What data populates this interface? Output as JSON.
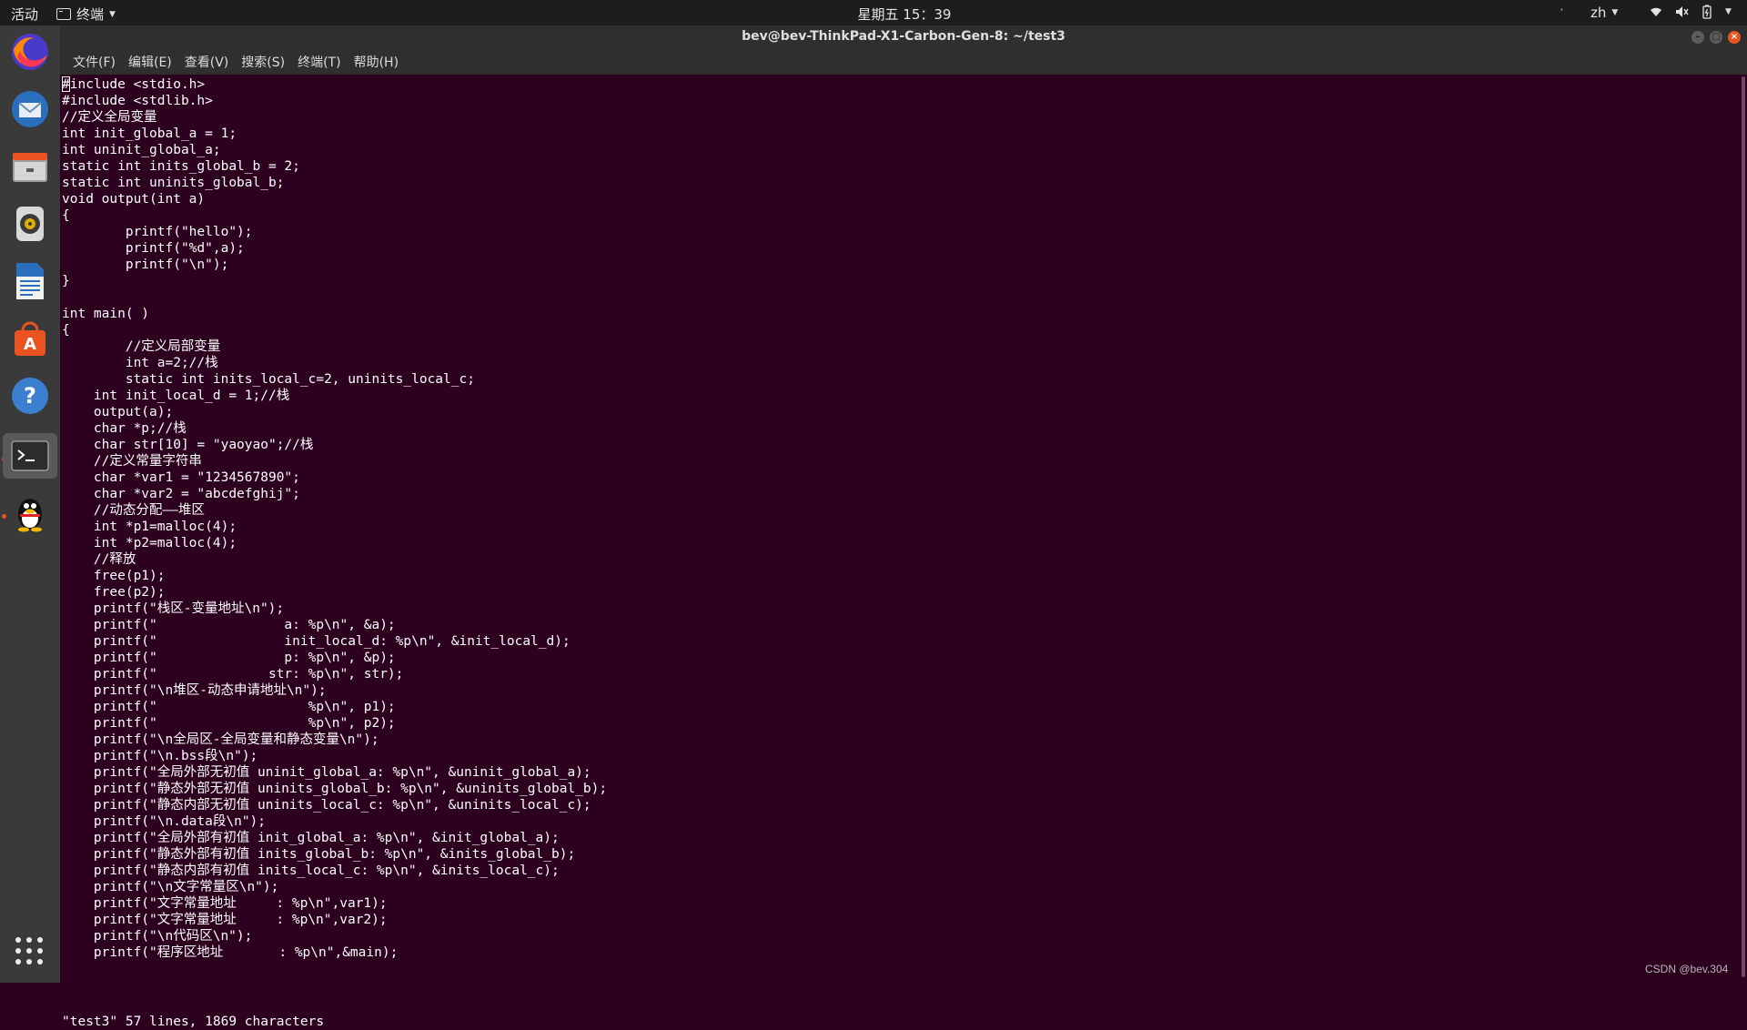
{
  "topbar": {
    "activities": "活动",
    "app_name": "终端",
    "clock": "星期五 15：39",
    "language": "zh"
  },
  "dock": {
    "apps": [
      {
        "name": "firefox",
        "icon": "firefox-icon",
        "running": false
      },
      {
        "name": "thunderbird",
        "icon": "thunderbird-mail-icon",
        "running": false
      },
      {
        "name": "files",
        "icon": "files-icon",
        "running": false
      },
      {
        "name": "rhythmbox",
        "icon": "rhythmbox-icon",
        "running": false
      },
      {
        "name": "libreoffice-writer",
        "icon": "writer-icon",
        "running": false
      },
      {
        "name": "software",
        "icon": "software-center-icon",
        "running": false
      },
      {
        "name": "help",
        "icon": "help-icon",
        "running": false
      },
      {
        "name": "terminal",
        "icon": "terminal-icon",
        "running": true
      },
      {
        "name": "qq",
        "icon": "qq-penguin-icon",
        "running": true
      }
    ]
  },
  "window": {
    "title": "bev@bev-ThinkPad-X1-Carbon-Gen-8: ~/test3",
    "menu": [
      "文件(F)",
      "编辑(E)",
      "查看(V)",
      "搜索(S)",
      "终端(T)",
      "帮助(H)"
    ]
  },
  "terminal": {
    "lines": [
      "#include <stdio.h>",
      "#include <stdlib.h>",
      "//定义全局变量",
      "int init_global_a = 1;",
      "int uninit_global_a;",
      "static int inits_global_b = 2;",
      "static int uninits_global_b;",
      "void output(int a)",
      "{",
      "        printf(\"hello\");",
      "        printf(\"%d\",a);",
      "        printf(\"\\n\");",
      "}",
      "",
      "int main( )",
      "{",
      "        //定义局部变量",
      "        int a=2;//栈",
      "        static int inits_local_c=2, uninits_local_c;",
      "    int init_local_d = 1;//栈",
      "    output(a);",
      "    char *p;//栈",
      "    char str[10] = \"yaoyao\";//栈",
      "    //定义常量字符串",
      "    char *var1 = \"1234567890\";",
      "    char *var2 = \"abcdefghij\";",
      "    //动态分配——堆区",
      "    int *p1=malloc(4);",
      "    int *p2=malloc(4);",
      "    //释放",
      "    free(p1);",
      "    free(p2);",
      "    printf(\"栈区-变量地址\\n\");",
      "    printf(\"                a: %p\\n\", &a);",
      "    printf(\"                init_local_d: %p\\n\", &init_local_d);",
      "    printf(\"                p: %p\\n\", &p);",
      "    printf(\"              str: %p\\n\", str);",
      "    printf(\"\\n堆区-动态申请地址\\n\");",
      "    printf(\"                   %p\\n\", p1);",
      "    printf(\"                   %p\\n\", p2);",
      "    printf(\"\\n全局区-全局变量和静态变量\\n\");",
      "    printf(\"\\n.bss段\\n\");",
      "    printf(\"全局外部无初值 uninit_global_a: %p\\n\", &uninit_global_a);",
      "    printf(\"静态外部无初值 uninits_global_b: %p\\n\", &uninits_global_b);",
      "    printf(\"静态内部无初值 uninits_local_c: %p\\n\", &uninits_local_c);",
      "    printf(\"\\n.data段\\n\");",
      "    printf(\"全局外部有初值 init_global_a: %p\\n\", &init_global_a);",
      "    printf(\"静态外部有初值 inits_global_b: %p\\n\", &inits_global_b);",
      "    printf(\"静态内部有初值 inits_local_c: %p\\n\", &inits_local_c);",
      "    printf(\"\\n文字常量区\\n\");",
      "    printf(\"文字常量地址     : %p\\n\",var1);",
      "    printf(\"文字常量地址     : %p\\n\",var2);",
      "    printf(\"\\n代码区\\n\");",
      "    printf(\"程序区地址       : %p\\n\",&main);"
    ],
    "status": "\"test3\" 57 lines, 1869 characters"
  },
  "watermark": "CSDN @bev.304",
  "colors": {
    "terminal_bg": "#2c001e",
    "accent": "#e95420"
  }
}
